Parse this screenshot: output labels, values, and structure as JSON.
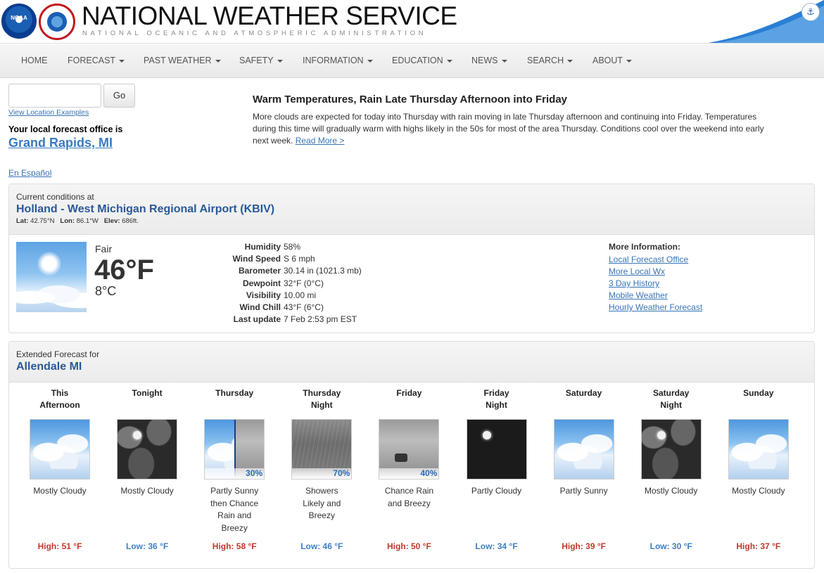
{
  "header": {
    "logo_noaa": "NOAA",
    "title": "NATIONAL WEATHER SERVICE",
    "subtitle": "NATIONAL OCEANIC AND ATMOSPHERIC ADMINISTRATION"
  },
  "nav": [
    {
      "label": "HOME",
      "dropdown": false
    },
    {
      "label": "FORECAST",
      "dropdown": true
    },
    {
      "label": "PAST WEATHER",
      "dropdown": true
    },
    {
      "label": "SAFETY",
      "dropdown": true
    },
    {
      "label": "INFORMATION",
      "dropdown": true
    },
    {
      "label": "EDUCATION",
      "dropdown": true
    },
    {
      "label": "NEWS",
      "dropdown": true
    },
    {
      "label": "SEARCH",
      "dropdown": true
    },
    {
      "label": "ABOUT",
      "dropdown": true
    }
  ],
  "search": {
    "value": "",
    "button": "Go",
    "examples_link": "View Location Examples"
  },
  "local_office": {
    "label": "Your local forecast office is",
    "name": "Grand Rapids, MI"
  },
  "espanol": "En Español",
  "headline": {
    "title": "Warm Temperatures, Rain Late Thursday Afternoon into Friday",
    "body": "More clouds are expected for today into Thursday with rain moving in late Thursday afternoon and continuing into Friday. Temperatures during this time will gradually warm with highs likely in the 50s for most of the area Thursday. Conditions cool over the weekend into early next week.",
    "read_more": "Read More >"
  },
  "current": {
    "label": "Current conditions at",
    "station": "Holland - West Michigan Regional Airport (KBIV)",
    "lat_label": "Lat:",
    "lat": "42.75°N",
    "lon_label": "Lon:",
    "lon": "86.1°W",
    "elev_label": "Elev:",
    "elev": "686ft.",
    "condition": "Fair",
    "temp_f": "46°F",
    "temp_c": "8°C",
    "details": [
      {
        "key": "Humidity",
        "value": "58%"
      },
      {
        "key": "Wind Speed",
        "value": "S 6 mph"
      },
      {
        "key": "Barometer",
        "value": "30.14 in (1021.3 mb)"
      },
      {
        "key": "Dewpoint",
        "value": "32°F (0°C)"
      },
      {
        "key": "Visibility",
        "value": "10.00 mi"
      },
      {
        "key": "Wind Chill",
        "value": "43°F (6°C)"
      },
      {
        "key": "Last update",
        "value": "7 Feb 2:53 pm EST"
      }
    ],
    "more_info_title": "More Information:",
    "more_info_links": [
      "Local Forecast Office",
      "More Local Wx",
      "3 Day History",
      "Mobile Weather",
      "Hourly Weather Forecast"
    ]
  },
  "extended": {
    "label": "Extended Forecast for",
    "location": "Allendale MI",
    "periods": [
      {
        "name1": "This",
        "name2": "Afternoon",
        "icon": "partly-sunny-day-icon",
        "pop": "",
        "short": [
          "Mostly Cloudy"
        ],
        "temp": "High: 51 °F",
        "kind": "high"
      },
      {
        "name1": "Tonight",
        "name2": "",
        "icon": "mostly-cloudy-night-icon",
        "pop": "",
        "short": [
          "Mostly Cloudy"
        ],
        "temp": "Low: 36 °F",
        "kind": "low"
      },
      {
        "name1": "Thursday",
        "name2": "",
        "icon": "sun-then-rain-icon",
        "pop": "30%",
        "short": [
          "Partly Sunny",
          "then Chance",
          "Rain and",
          "Breezy"
        ],
        "temp": "High: 58 °F",
        "kind": "high"
      },
      {
        "name1": "Thursday",
        "name2": "Night",
        "icon": "rain-showers-icon",
        "pop": "70%",
        "short": [
          "Showers",
          "Likely and",
          "Breezy"
        ],
        "temp": "Low: 46 °F",
        "kind": "low"
      },
      {
        "name1": "Friday",
        "name2": "",
        "icon": "rain-breezy-icon",
        "pop": "40%",
        "short": [
          "Chance Rain",
          "and Breezy"
        ],
        "temp": "High: 50 °F",
        "kind": "high"
      },
      {
        "name1": "Friday",
        "name2": "Night",
        "icon": "partly-cloudy-night-icon",
        "pop": "",
        "short": [
          "Partly Cloudy"
        ],
        "temp": "Low: 34 °F",
        "kind": "low"
      },
      {
        "name1": "Saturday",
        "name2": "",
        "icon": "partly-sunny-day-icon",
        "pop": "",
        "short": [
          "Partly Sunny"
        ],
        "temp": "High: 39 °F",
        "kind": "high"
      },
      {
        "name1": "Saturday",
        "name2": "Night",
        "icon": "mostly-cloudy-night-icon",
        "pop": "",
        "short": [
          "Mostly Cloudy"
        ],
        "temp": "Low: 30 °F",
        "kind": "low"
      },
      {
        "name1": "Sunday",
        "name2": "",
        "icon": "mostly-cloudy-day-icon",
        "pop": "",
        "short": [
          "Mostly Cloudy"
        ],
        "temp": "High: 37 °F",
        "kind": "high"
      }
    ]
  },
  "colors": {
    "link": "#3974b5",
    "title_blue": "#29599a",
    "high_red": "#c0392b",
    "low_blue": "#3d7fc5"
  }
}
